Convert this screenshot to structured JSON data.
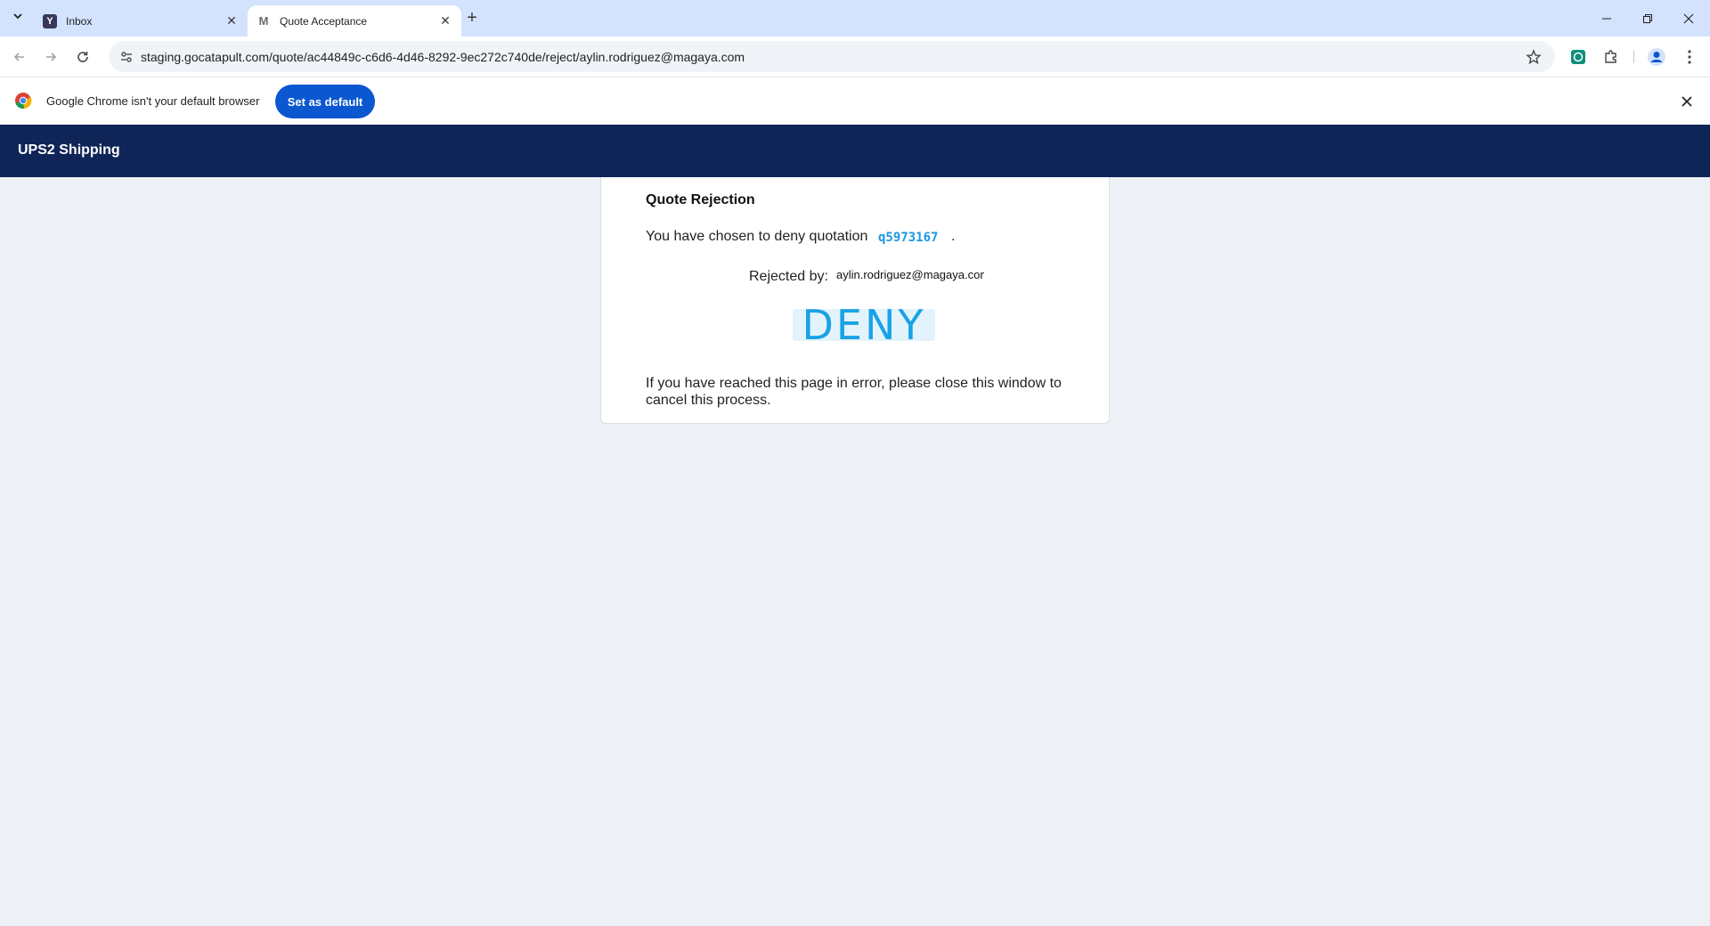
{
  "browser": {
    "tabs": [
      {
        "title": "Inbox",
        "favicon": "Y",
        "active": false
      },
      {
        "title": "Quote Acceptance",
        "favicon": "M",
        "active": true
      }
    ],
    "url": "staging.gocatapult.com/quote/ac44849c-c6d6-4d46-8292-9ec272c740de/reject/aylin.rodriguez@magaya.com",
    "infobar": {
      "message": "Google Chrome isn't your default browser",
      "button_label": "Set as default"
    },
    "icons": {
      "tab_search": "chevron-down-icon",
      "new_tab": "plus-icon",
      "back": "back-arrow-icon",
      "forward": "forward-arrow-icon",
      "reload": "reload-icon",
      "site_info": "tune-icon",
      "bookmark": "star-icon",
      "extension": "extension-icon",
      "puzzle": "puzzle-icon",
      "profile": "profile-icon",
      "menu": "kebab-menu-icon"
    }
  },
  "app": {
    "brand": "UPS2 Shipping",
    "brand_color": "#0f2557"
  },
  "card": {
    "heading": "Quote Rejection",
    "line1_text": "You have chosen to deny quotation",
    "quote_id": "q5973167",
    "line1_end": ".",
    "rejected_by_label": "Rejected by:",
    "rejected_by_value": "aylin.rodriguez@magaya.com",
    "deny_label": "DENY",
    "note": "If you have reached this page in error, please close this window to cancel this process.",
    "accent_color": "#1aa2e6"
  }
}
